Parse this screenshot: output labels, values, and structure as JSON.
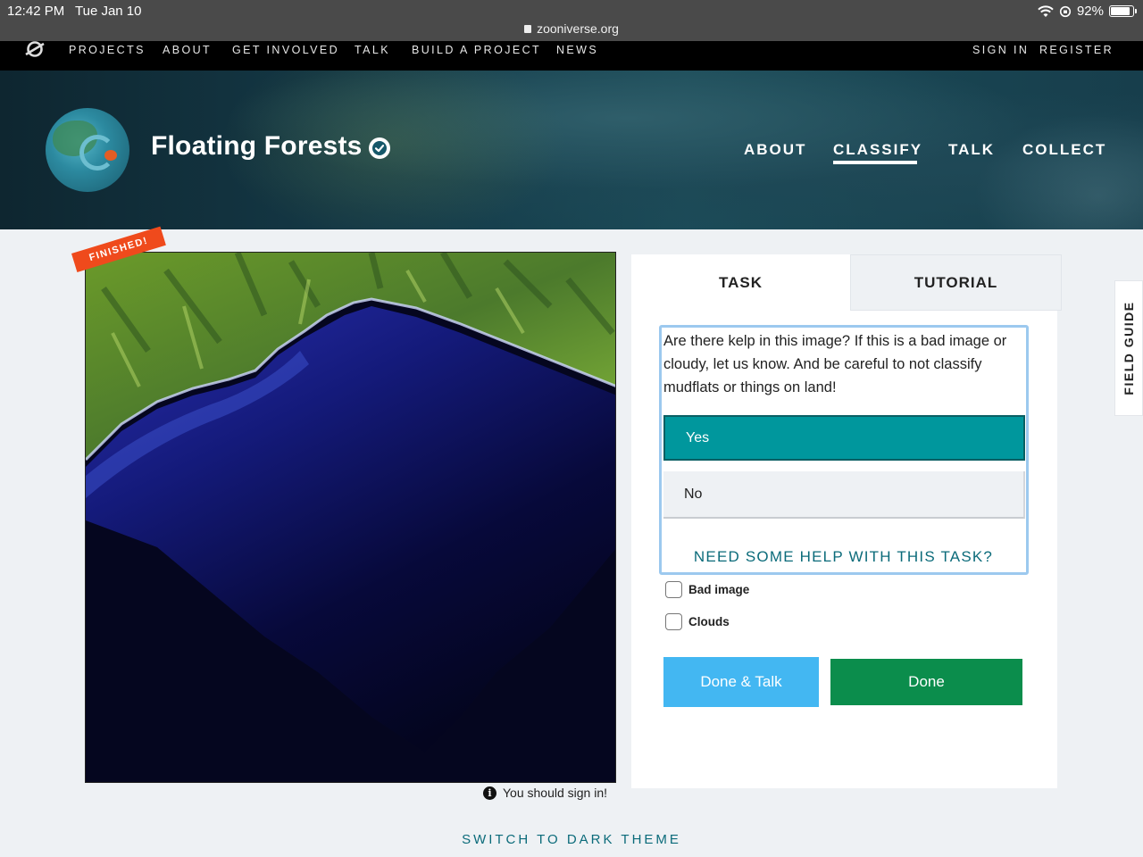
{
  "status_bar": {
    "time": "12:42 PM",
    "date": "Tue Jan 10",
    "url": "zooniverse.org",
    "battery": "92%"
  },
  "top_nav": {
    "links": [
      "PROJECTS",
      "ABOUT",
      "GET INVOLVED",
      "TALK",
      "BUILD A PROJECT",
      "NEWS"
    ],
    "sign_in": "SIGN IN",
    "register": "REGISTER"
  },
  "project": {
    "title": "Floating Forests",
    "nav": [
      "ABOUT",
      "CLASSIFY",
      "TALK",
      "COLLECT"
    ],
    "active_nav": "CLASSIFY"
  },
  "subject": {
    "badge": "FINISHED!",
    "notice": "You should sign in!"
  },
  "task_panel": {
    "tabs": [
      "TASK",
      "TUTORIAL"
    ],
    "question": "Are there kelp in this image? If this is a bad image or cloudy, let us know. And be careful to not classify mudflats or things on land!",
    "answers": [
      {
        "label": "Yes",
        "selected": true
      },
      {
        "label": "No",
        "selected": false
      }
    ],
    "help": "NEED SOME HELP WITH THIS TASK?",
    "checkboxes": [
      {
        "label": "Bad image",
        "checked": false
      },
      {
        "label": "Clouds",
        "checked": false
      }
    ],
    "done_talk": "Done & Talk",
    "done": "Done"
  },
  "field_guide": "FIELD GUIDE",
  "footer": {
    "theme_toggle": "SWITCH TO DARK THEME"
  },
  "colors": {
    "accent_teal": "#00979d",
    "done_green": "#0b8d4c",
    "done_talk_blue": "#43b7f2",
    "badge_orange": "#ef4a1c",
    "link_teal": "#0b6b7a"
  }
}
